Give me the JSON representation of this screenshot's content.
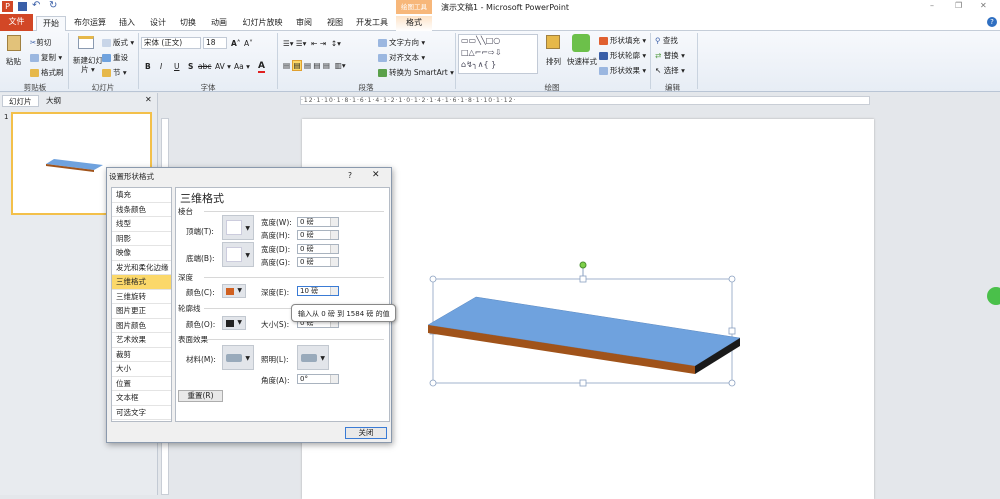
{
  "window": {
    "title": "演示文稿1 - Microsoft PowerPoint",
    "context_tab_group": "绘图工具",
    "minimize": "–",
    "restore": "❐",
    "close": "✕"
  },
  "qat": {
    "app_icon": "P"
  },
  "tabs": [
    {
      "label": "文件"
    },
    {
      "label": "开始"
    },
    {
      "label": "布尔运算"
    },
    {
      "label": "插入"
    },
    {
      "label": "设计"
    },
    {
      "label": "切换"
    },
    {
      "label": "动画"
    },
    {
      "label": "幻灯片放映"
    },
    {
      "label": "审阅"
    },
    {
      "label": "视图"
    },
    {
      "label": "开发工具"
    },
    {
      "label": "格式"
    }
  ],
  "ribbon": {
    "clipboard": {
      "paste": "粘贴",
      "cut": "剪切",
      "copy": "复制 ▾",
      "format_painter": "格式刷",
      "label": "剪贴板"
    },
    "slides": {
      "new_slide": "新建幻灯片 ▾",
      "layout": "版式 ▾",
      "reset": "重设",
      "section": "节 ▾",
      "label": "幻灯片"
    },
    "font": {
      "font_name": "宋体 (正文)",
      "font_size": "18",
      "bold": "B",
      "italic": "I",
      "underline": "U",
      "strike": "S",
      "shadow": "abc",
      "spacing": "AV ▾",
      "case": "Aa ▾",
      "color": "A",
      "grow": "A˄",
      "shrink": "A˅",
      "label": "字体"
    },
    "paragraph": {
      "text_direction": "文字方向 ▾",
      "align_text": "对齐文本 ▾",
      "smartart": "转换为 SmartArt ▾",
      "label": "段落"
    },
    "drawing": {
      "arrange": "排列",
      "quick_styles": "快速样式",
      "shape_fill": "形状填充 ▾",
      "shape_outline": "形状轮廓 ▾",
      "shape_effects": "形状效果 ▾",
      "label": "绘图"
    },
    "editing": {
      "find": "查找",
      "replace": "替换 ▾",
      "select": "选择 ▾",
      "label": "编辑"
    }
  },
  "pane": {
    "tabs": [
      "幻灯片",
      "大纲"
    ],
    "close": "✕",
    "slide_number": "1"
  },
  "ruler": {
    "h": "·12·1·10·1·8·1·6·1·4·1·2·1·0·1·2·1·4·1·6·1·8·1·10·1·12·"
  },
  "dialog": {
    "title": "设置形状格式",
    "help": "?",
    "close": "✕",
    "categories": [
      "填充",
      "线条颜色",
      "线型",
      "阴影",
      "映像",
      "发光和柔化边缘",
      "三维格式",
      "三维旋转",
      "图片更正",
      "图片颜色",
      "艺术效果",
      "裁剪",
      "大小",
      "位置",
      "文本框",
      "可选文字"
    ],
    "selected_category": "三维格式",
    "heading": "三维格式",
    "bevel": {
      "label": "棱台",
      "top": "顶端(T):",
      "bottom": "底端(B):",
      "top_width_label": "宽度(W):",
      "top_width": "0 磅",
      "top_height_label": "高度(H):",
      "top_height": "0 磅",
      "bottom_width_label": "宽度(D):",
      "bottom_width": "0 磅",
      "bottom_height_label": "高度(G):",
      "bottom_height": "0 磅"
    },
    "depth": {
      "label": "深度",
      "color": "颜色(C):",
      "depth_label": "深度(E):",
      "depth_value": "10 磅"
    },
    "contour": {
      "label": "轮廓线",
      "color": "颜色(O):",
      "size_label": "大小(S):",
      "size_value": "0 磅"
    },
    "surface": {
      "label": "表面效果",
      "material": "材料(M):",
      "lighting": "照明(L):",
      "angle_label": "角度(A):",
      "angle_value": "0°"
    },
    "reset": "重置(R)",
    "close_button": "关闭",
    "tooltip": "输入从 0 磅 到 1584 磅 的值"
  },
  "colors": {
    "accent": "#d24726",
    "shape_top": "#6fa2de",
    "shape_front": "#a0531a",
    "shape_side": "#1a1a1a",
    "selected": "#fbd86a"
  }
}
